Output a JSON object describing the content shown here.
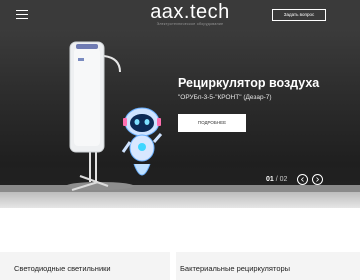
{
  "header": {
    "logo": "aax.tech",
    "logo_tagline": "Электротехническое оборудование",
    "ask_button": "Задать вопрос",
    "menu_icon": "hamburger-icon"
  },
  "hero": {
    "title": "Рециркулятор воздуха",
    "subtitle": "\"ОРУБп-3-5-\"КРОНТ\" (Дезар-7)",
    "more_button": "ПОДРОБНЕЕ",
    "slide_current": "01",
    "slide_separator": "/",
    "slide_total": "02",
    "prev_icon": "chevron-left-icon",
    "next_icon": "chevron-right-icon"
  },
  "categories": [
    {
      "title": "Светодиодные светильники"
    },
    {
      "title": "Бактериальные рециркуляторы"
    }
  ],
  "colors": {
    "header_bg": "#3a3a3a",
    "hero_bg": "#2a2a2a",
    "button_bg": "#ffffff",
    "card_bg": "#f4f4f4"
  }
}
